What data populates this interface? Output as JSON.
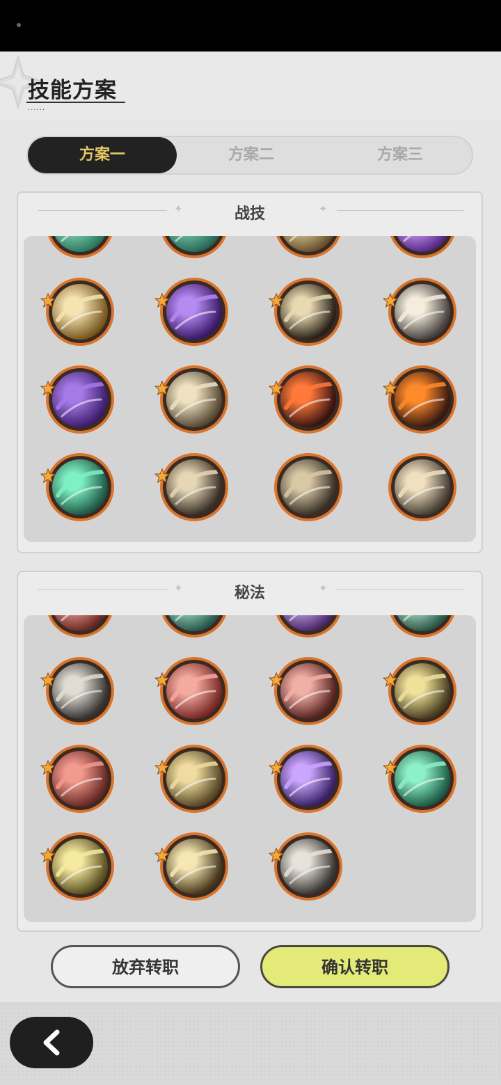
{
  "page": {
    "title": "技能方案",
    "title_dots": "......"
  },
  "tabs": [
    {
      "label": "方案一",
      "active": true
    },
    {
      "label": "方案二",
      "active": false
    },
    {
      "label": "方案三",
      "active": false
    }
  ],
  "combat_section": {
    "title": "战技",
    "skills": [
      {
        "icon": "teal-rune-skill-icon",
        "colors": [
          "#2f7a62",
          "#8fe0c0"
        ],
        "starred": false,
        "partial": true
      },
      {
        "icon": "teal-glyph-skill-icon",
        "colors": [
          "#2b6a5a",
          "#7ad8b2"
        ],
        "starred": false,
        "partial": true
      },
      {
        "icon": "gold-arrow-skill-icon",
        "colors": [
          "#6a5430",
          "#e8d6a0"
        ],
        "starred": false,
        "partial": true
      },
      {
        "icon": "purple-swirl-skill-icon",
        "colors": [
          "#5a2a8a",
          "#d6a6ff"
        ],
        "starred": false,
        "partial": true
      },
      {
        "icon": "gold-slash-skill-icon",
        "colors": [
          "#7a5a20",
          "#f5e3b2"
        ],
        "starred": true,
        "partial": false
      },
      {
        "icon": "purple-heart-skill-icon",
        "colors": [
          "#3a1a6a",
          "#b68af0"
        ],
        "starred": true,
        "partial": false
      },
      {
        "icon": "dark-crack-skill-icon",
        "colors": [
          "#2a2218",
          "#e8d9b0"
        ],
        "starred": true,
        "partial": false
      },
      {
        "icon": "white-fist-skill-icon",
        "colors": [
          "#4a4440",
          "#f4ecdc"
        ],
        "starred": true,
        "partial": false
      },
      {
        "icon": "purple-shadow-skill-icon",
        "colors": [
          "#3e1e6e",
          "#a67ae6"
        ],
        "starred": true,
        "partial": false
      },
      {
        "icon": "wind-hand-skill-icon",
        "colors": [
          "#5a4c36",
          "#efe2c2"
        ],
        "starred": true,
        "partial": false
      },
      {
        "icon": "fire-slash-skill-icon",
        "colors": [
          "#3a1410",
          "#ff7a3a"
        ],
        "starred": true,
        "partial": false
      },
      {
        "icon": "flame-ring-skill-icon",
        "colors": [
          "#3a1a10",
          "#ff8a2a"
        ],
        "starred": true,
        "partial": false
      },
      {
        "icon": "green-arrows-skill-icon",
        "colors": [
          "#1e5a48",
          "#7ef0c2"
        ],
        "starred": true,
        "partial": false
      },
      {
        "icon": "gale-streak-skill-icon",
        "colors": [
          "#3a3228",
          "#e6d6b4"
        ],
        "starred": true,
        "partial": false
      },
      {
        "icon": "spin-vortex-skill-icon",
        "colors": [
          "#3a3228",
          "#d8c8a4"
        ],
        "starred": false,
        "partial": false
      },
      {
        "icon": "tornado-skill-icon",
        "colors": [
          "#4a4236",
          "#f0e0c0"
        ],
        "starred": false,
        "partial": false
      }
    ]
  },
  "secret_section": {
    "title": "秘法",
    "skills": [
      {
        "icon": "red-crest-skill-icon",
        "colors": [
          "#6a2a24",
          "#f0a49a"
        ],
        "starred": false,
        "partial": true
      },
      {
        "icon": "teal-crest-skill-icon",
        "colors": [
          "#2a5a4e",
          "#a6e6d0"
        ],
        "starred": false,
        "partial": true
      },
      {
        "icon": "purple-crest-skill-icon",
        "colors": [
          "#4a2a6a",
          "#d0b0f0"
        ],
        "starred": false,
        "partial": true
      },
      {
        "icon": "green-crest-skill-icon",
        "colors": [
          "#2a5a48",
          "#bfe8d6"
        ],
        "starred": false,
        "partial": true
      },
      {
        "icon": "silver-blade-skill-icon",
        "colors": [
          "#3a3634",
          "#e0dcd4"
        ],
        "starred": true,
        "partial": false
      },
      {
        "icon": "crimson-sword-skill-icon",
        "colors": [
          "#7a2a26",
          "#f4aaa0"
        ],
        "starred": true,
        "partial": false
      },
      {
        "icon": "red-strike-skill-icon",
        "colors": [
          "#5a2420",
          "#f0b0a6"
        ],
        "starred": true,
        "partial": false
      },
      {
        "icon": "gold-party-skill-icon",
        "colors": [
          "#4a4020",
          "#f0e09a"
        ],
        "starred": true,
        "partial": false
      },
      {
        "icon": "red-armor-skill-icon",
        "colors": [
          "#6a2a26",
          "#f29a8e"
        ],
        "starred": true,
        "partial": false
      },
      {
        "icon": "gold-armor-skill-icon",
        "colors": [
          "#5a4a26",
          "#f0dca0"
        ],
        "starred": true,
        "partial": false
      },
      {
        "icon": "purple-figure-skill-icon",
        "colors": [
          "#3a2266",
          "#caa6ff"
        ],
        "starred": true,
        "partial": false
      },
      {
        "icon": "green-blade-skill-icon",
        "colors": [
          "#1e5e48",
          "#8ef0c8"
        ],
        "starred": true,
        "partial": false
      },
      {
        "icon": "gold-heal-skill-icon",
        "colors": [
          "#5a5020",
          "#f6eaa0"
        ],
        "starred": true,
        "partial": false
      },
      {
        "icon": "gold-eye-skill-icon",
        "colors": [
          "#4a3a1e",
          "#f6e6b4"
        ],
        "starred": true,
        "partial": false
      },
      {
        "icon": "silver-sword-skill-icon",
        "colors": [
          "#3a3634",
          "#e6e2da"
        ],
        "starred": true,
        "partial": false
      }
    ]
  },
  "buttons": {
    "cancel": "放弃转职",
    "confirm": "确认转职"
  },
  "colors": {
    "tab_active_bg": "#222222",
    "tab_active_text": "#e6c764",
    "ring": "#d9742c",
    "confirm_bg": "#e4ea78"
  },
  "nav": {
    "back_icon": "chevron-left-icon"
  }
}
